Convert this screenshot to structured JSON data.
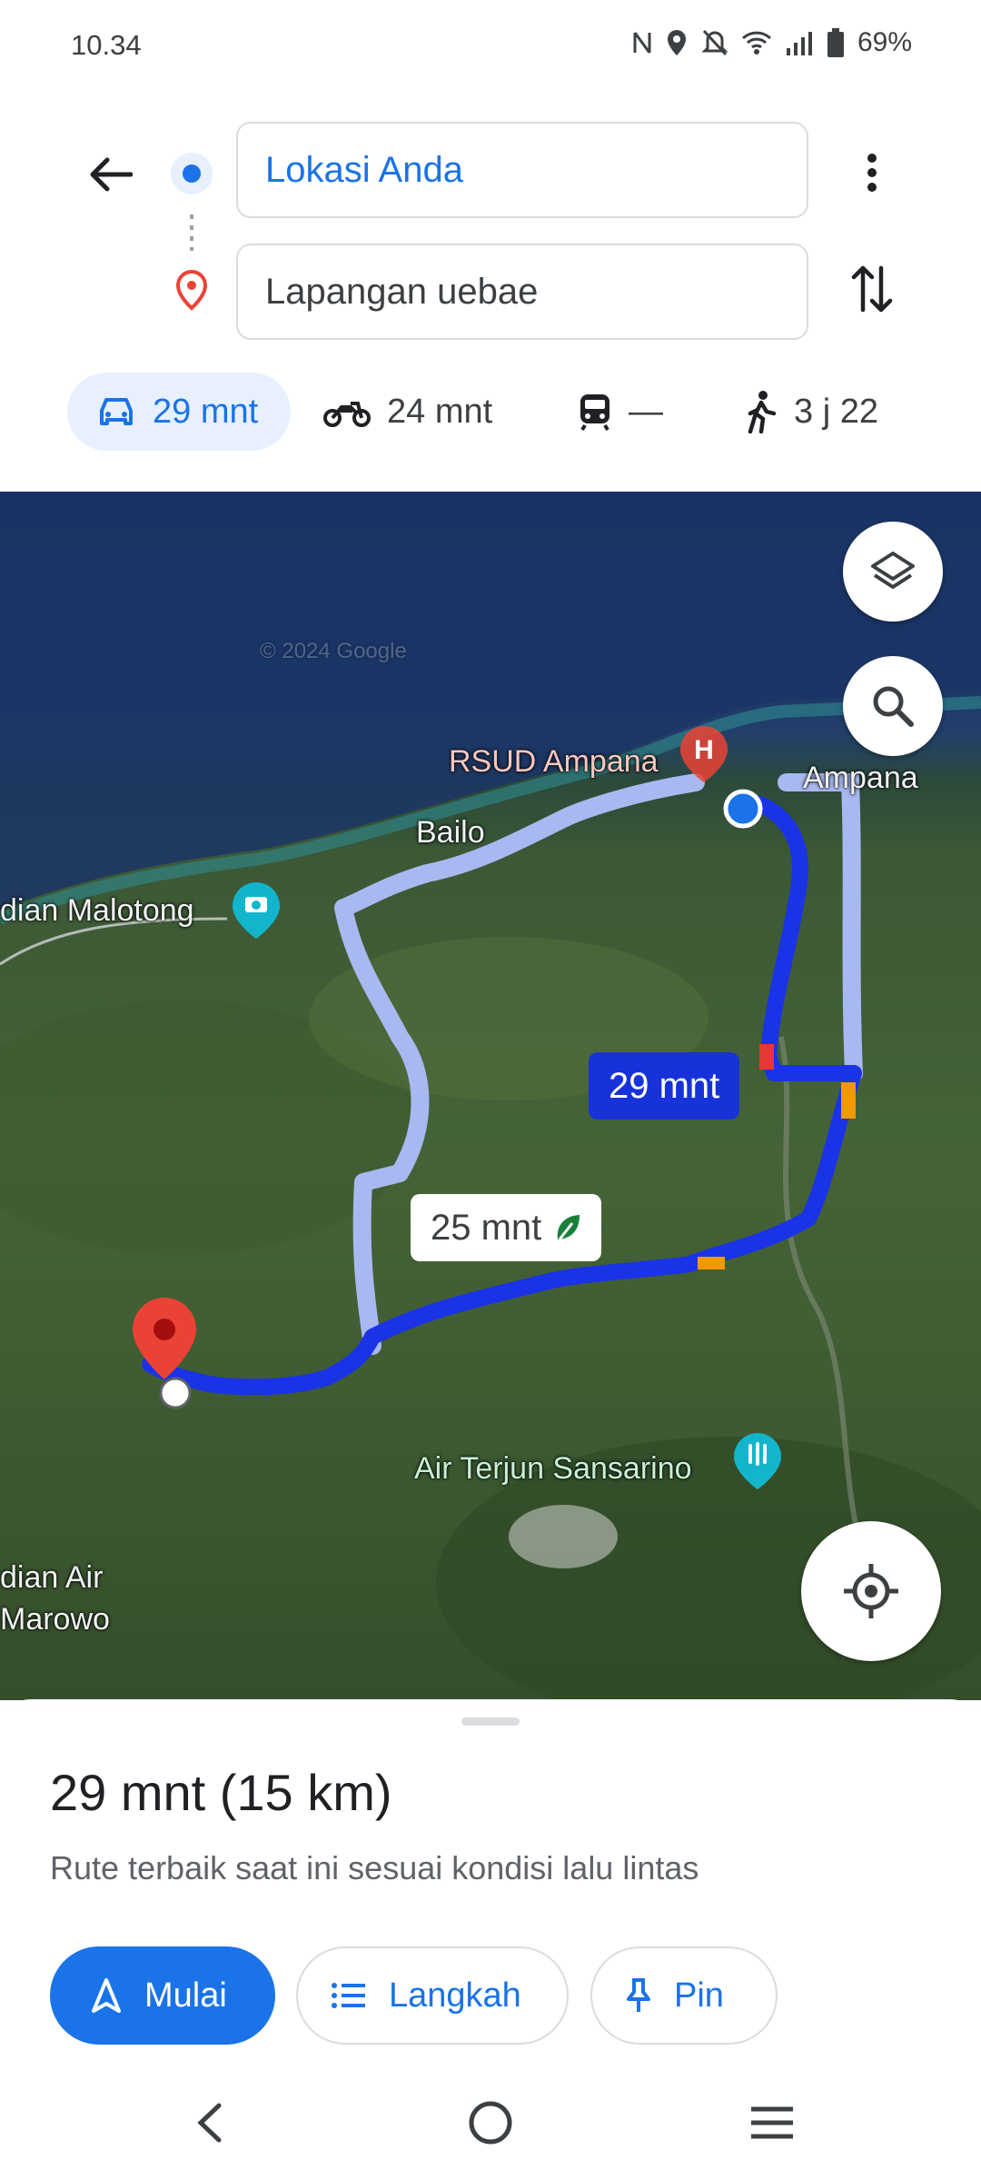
{
  "status_bar": {
    "time": "10.34",
    "battery": "69%",
    "icons": [
      "nfc-icon",
      "location-icon",
      "mute-icon",
      "wifi-icon",
      "signal-icon",
      "battery-icon"
    ]
  },
  "directions": {
    "origin": "Lokasi Anda",
    "destination": "Lapangan uebae"
  },
  "modes": [
    {
      "name": "car",
      "label": "29 mnt",
      "selected": true
    },
    {
      "name": "motorcycle",
      "label": "24 mnt"
    },
    {
      "name": "transit",
      "label": "—"
    },
    {
      "name": "walk",
      "label": "3 j 22"
    }
  ],
  "map": {
    "watermark": "© 2024 Google",
    "labels": {
      "rsud": "RSUD Ampana",
      "ampana": "Ampana",
      "bailo": "Bailo",
      "malotong": "dian Malotong",
      "sansarino": "Air Terjun Sansarino",
      "air_marowo_1": "dian Air",
      "air_marowo_2": "Marowo"
    },
    "route_main_label": "29 mnt",
    "route_alt_label": "25 mnt",
    "route_color": "#1a33e6",
    "alt_route_color": "#a9b8f0"
  },
  "sheet": {
    "summary": "29 mnt (15 km)",
    "description": "Rute terbaik saat ini sesuai kondisi lalu lintas",
    "start_label": "Mulai",
    "steps_label": "Langkah",
    "pin_label": "Pin"
  },
  "colors": {
    "accent": "#1a73e8",
    "destination_pin": "#ea4335"
  }
}
